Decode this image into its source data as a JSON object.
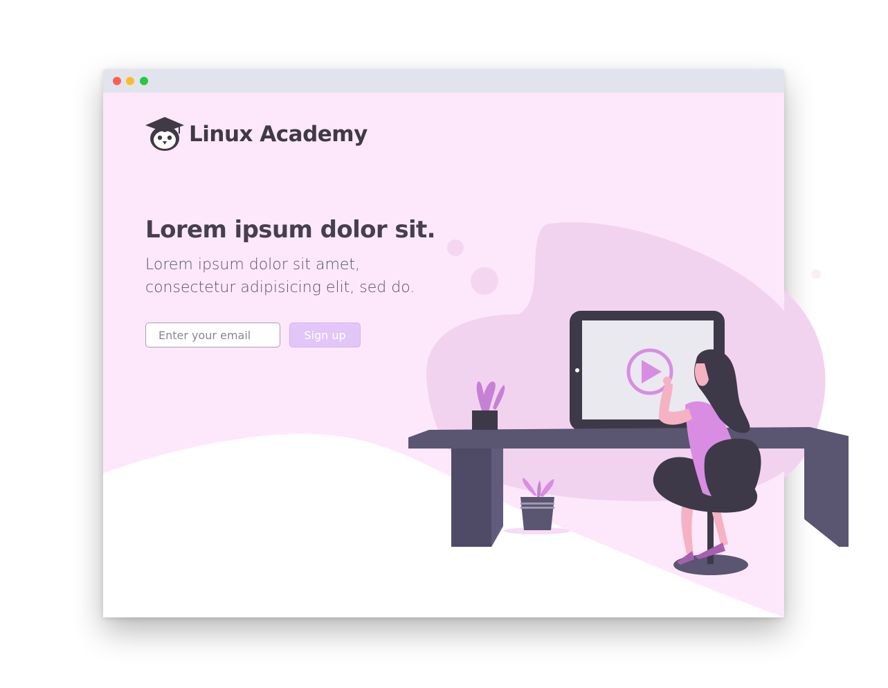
{
  "window": {
    "controls": [
      "close",
      "minimize",
      "maximize"
    ]
  },
  "brand": {
    "name": "Linux Academy",
    "logo_icon": "owl-graduation-cap-icon"
  },
  "hero": {
    "headline": "Lorem ipsum dolor sit.",
    "subtext": "Lorem ipsum dolor sit amet, consectetur adipisicing elit, sed do."
  },
  "signup_form": {
    "email_placeholder": "Enter your email",
    "email_value": "",
    "button_label": "Sign up"
  },
  "illustration": {
    "description_icon": "woman-watching-video-on-tablet-illustration",
    "play_icon": "play-icon"
  },
  "colors": {
    "page_background": "#fde8fb",
    "accent": "#e2c6f8",
    "dark": "#3f3a45",
    "desk": "#5a5570",
    "pink": "#d88de3"
  }
}
